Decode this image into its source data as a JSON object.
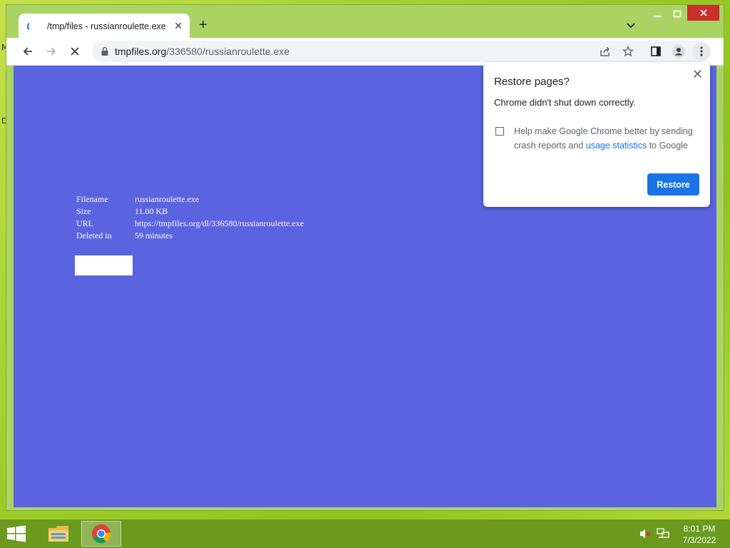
{
  "desktop": {
    "edge_letters": [
      "M",
      "D"
    ]
  },
  "browser": {
    "tab": {
      "title": "/tmp/files - russianroulette.exe",
      "close_glyph": "✕"
    },
    "new_tab_glyph": "+",
    "window_controls": {
      "minimize": "▁",
      "maximize": "□",
      "close": "✕"
    },
    "address": {
      "host": "tmpfiles.org",
      "path": "/336580/russianroulette.exe"
    }
  },
  "page": {
    "rows": [
      {
        "label": "Filename",
        "value": "russianroulette.exe"
      },
      {
        "label": "Size",
        "value": "11.00 KB"
      },
      {
        "label": "URL",
        "value": "https://tmpfiles.org/dl/336580/russianroulette.exe"
      },
      {
        "label": "Deleted in",
        "value": "59 minutes"
      }
    ]
  },
  "restore_bubble": {
    "title": "Restore pages?",
    "message": "Chrome didn't shut down correctly.",
    "checkbox_text_before": "Help make Google Chrome better by sending crash reports and ",
    "checkbox_link": "usage statistics",
    "checkbox_text_after": " to Google",
    "button": "Restore",
    "close_glyph": "✕"
  },
  "taskbar": {
    "time": "8:01 PM",
    "date": "7/3/2022"
  },
  "colors": {
    "page_bg": "#5a64e0",
    "accent": "#1a73e8",
    "taskbar": "#6a9a1e"
  }
}
